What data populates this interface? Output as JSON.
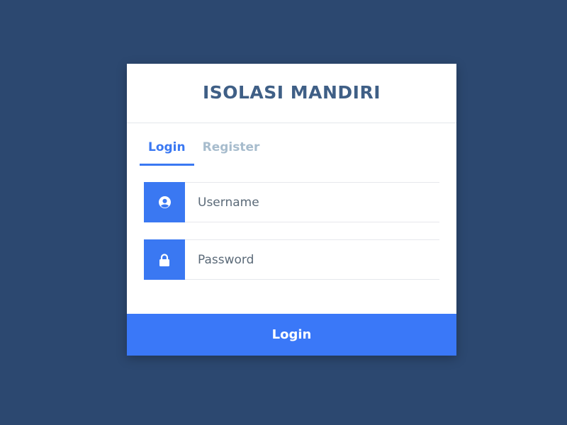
{
  "app": {
    "title": "ISOLASI MANDIRI"
  },
  "tabs": [
    {
      "label": "Login",
      "active": true
    },
    {
      "label": "Register",
      "active": false
    }
  ],
  "form": {
    "username": {
      "placeholder": "Username",
      "value": "",
      "icon": "user-circle-icon"
    },
    "password": {
      "placeholder": "Password",
      "value": "",
      "icon": "lock-icon"
    },
    "submit_label": "Login"
  },
  "colors": {
    "background": "#2c4870",
    "accent": "#3a78f2",
    "title": "#3f5f86",
    "inactive_tab": "#a7bccd"
  }
}
